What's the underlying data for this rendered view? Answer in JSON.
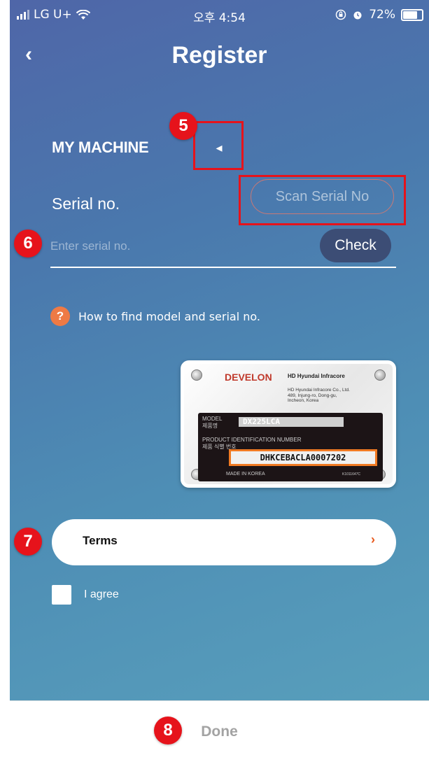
{
  "status_bar": {
    "carrier": "LG U+",
    "time": "오후 4:54",
    "battery": "72%",
    "icons": [
      "signal-icon",
      "wifi-icon",
      "lock-rotation-icon",
      "alarm-icon",
      "battery-icon"
    ]
  },
  "header": {
    "back_icon": "‹",
    "title": "Register"
  },
  "machine": {
    "section_title": "MY MACHINE",
    "arrow_icon": "◂"
  },
  "serial": {
    "label": "Serial no.",
    "scan_button": "Scan Serial No",
    "placeholder": "Enter serial no.",
    "check_button": "Check"
  },
  "help": {
    "icon": "?",
    "text": "How to find model and serial no."
  },
  "plate": {
    "brand": "DEVELON",
    "maker": "HD Hyundai Infracore",
    "company": "HD Hyundai Infracore Co., Ltd.",
    "address1": "489, Injung-ro, Dong-gu,",
    "address2": "Incheon, Korea",
    "model_label": "MODEL",
    "model_label_kr": "제품명",
    "model_value": "DX225LCA",
    "pin_label": "PRODUCT IDENTIFICATION NUMBER",
    "pin_label_kr": "제품 식별 번호",
    "serial_value": "DHKCEBACLA0007202",
    "made_in": "MADE IN KOREA",
    "code": "K1011647C"
  },
  "terms": {
    "label": "Terms",
    "chevron": "›"
  },
  "agree": {
    "label": "I agree"
  },
  "footer": {
    "done_button": "Done"
  },
  "annotations": {
    "m5": "5",
    "m6": "6",
    "m7": "7",
    "m8": "8",
    "color": "#e6131b"
  },
  "colors": {
    "gradient_top": "#4f66a8",
    "gradient_bottom": "#5aa2bd",
    "check_button_bg": "#3c4d75",
    "help_icon": "#ee7a45",
    "terms_chevron": "#e8591c",
    "done_text": "#a3a3a3"
  }
}
